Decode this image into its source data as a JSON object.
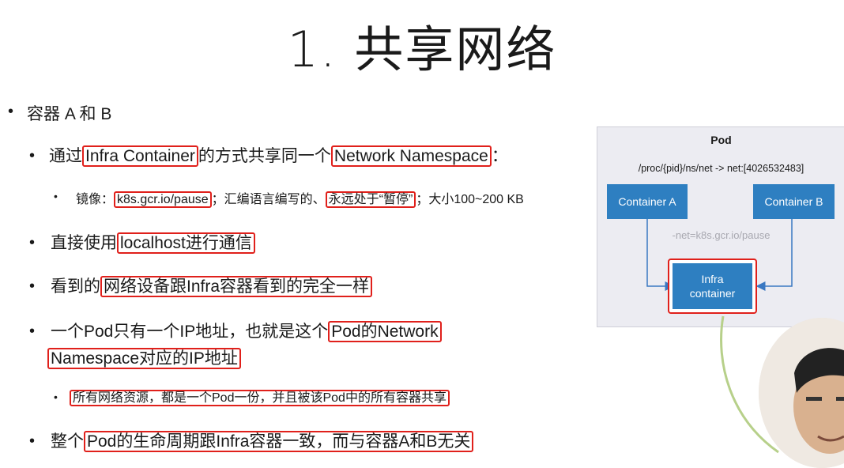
{
  "title": "1. 共享网络",
  "bullets": {
    "b1": "容器 A 和 B",
    "b2": {
      "pre": "通过",
      "box1": "Infra Container",
      "mid": "的方式共享同一个",
      "box2": "Network Namespace",
      "post": "："
    },
    "b3": {
      "pre": "镜像：",
      "box1": "k8s.gcr.io/pause",
      "mid": "；汇编语言编写的、",
      "box2": "永远处于“暂停”",
      "post": "；大小100~200 KB"
    },
    "b4": {
      "pre": "直接使用",
      "box": "localhost进行通信"
    },
    "b5": {
      "pre": "看到的",
      "box": "网络设备跟Infra容器看到的完全一样"
    },
    "b6": {
      "pre": "一个Pod只有一个IP地址，也就是这个",
      "box1": "Pod的Network",
      "box2": "Namespace对应的IP地址"
    },
    "b7": {
      "box": "所有网络资源，都是一个Pod一份，并且被该Pod中的所有容器共享"
    },
    "b8": {
      "pre": "整个",
      "box": "Pod的生命周期跟Infra容器一致，而与容器A和B无关"
    }
  },
  "diagram": {
    "pod_label": "Pod",
    "path": "/proc/{pid}/ns/net -> net:[4026532483]",
    "container_a": "Container A",
    "container_b": "Container B",
    "net_flag": "-net=k8s.gcr.io/pause",
    "infra_line1": "Infra",
    "infra_line2": "container",
    "colors": {
      "container": "#2e7fc1",
      "highlight": "#e0201b",
      "pod_bg": "#ececf2",
      "cable": "#b7d08a"
    }
  }
}
